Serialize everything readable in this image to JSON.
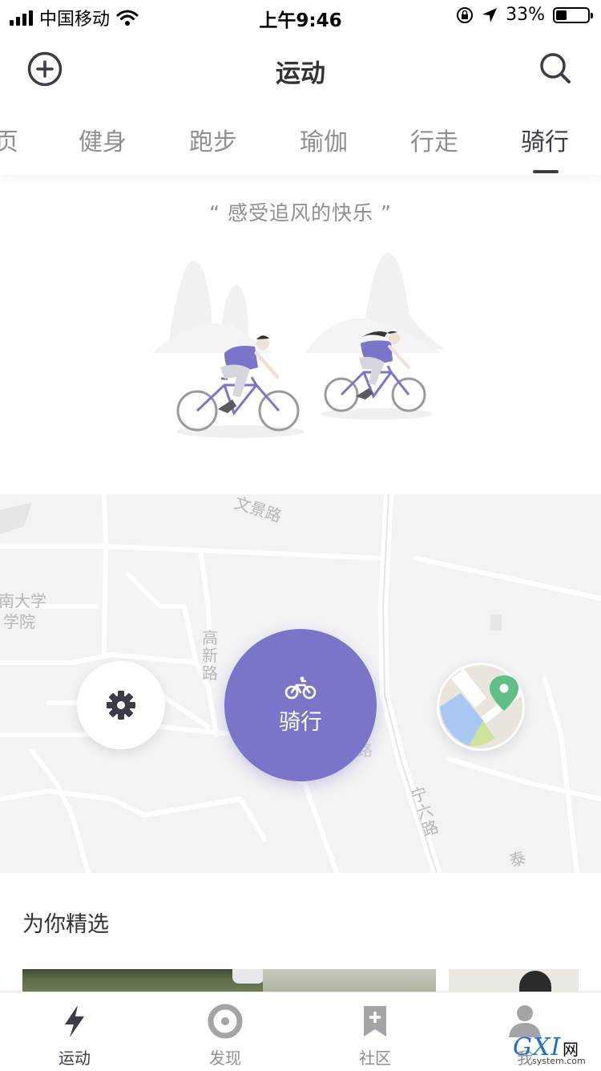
{
  "status_bar": {
    "carrier": "中国移动",
    "time": "上午9:46",
    "battery": "33%",
    "battery_level": 0.33
  },
  "nav": {
    "title": "运动",
    "add_icon": "plus-circle-icon",
    "search_icon": "search-icon"
  },
  "tabs": [
    {
      "label": "页"
    },
    {
      "label": "健身"
    },
    {
      "label": "跑步"
    },
    {
      "label": "瑜伽"
    },
    {
      "label": "行走"
    },
    {
      "label": "骑行"
    }
  ],
  "active_tab": "骑行",
  "hero": {
    "slogan": "“ 感受追风的快乐 ”"
  },
  "map": {
    "labels": [
      "文景路",
      "南大学",
      "学院",
      "高新路",
      "宁六路",
      "泰",
      "路"
    ]
  },
  "controls": {
    "settings_icon": "gear-icon",
    "start_label": "骑行",
    "start_icon": "bicycle-icon",
    "map_icon": "map-pin-icon"
  },
  "featured": {
    "title": "为你精选"
  },
  "tabbar": [
    {
      "label": "运动",
      "icon": "lightning-icon"
    },
    {
      "label": "发现",
      "icon": "target-icon"
    },
    {
      "label": "社区",
      "icon": "bookmark-plus-icon"
    },
    {
      "label": "我",
      "icon": "person-icon"
    }
  ],
  "colors": {
    "accent": "#7a75c9",
    "dark": "#3c3b47",
    "muted": "#8e8e93"
  },
  "watermark": {
    "brand": "GXI",
    "suffix": "网",
    "domain": "system.com"
  }
}
